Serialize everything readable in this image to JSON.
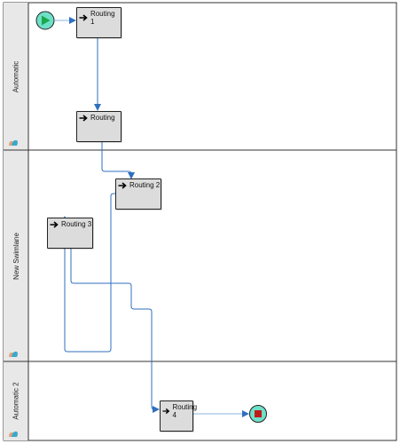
{
  "lanes": [
    {
      "label": "Automatic"
    },
    {
      "label": "New Swimlane"
    },
    {
      "label": "Automatic 2"
    }
  ],
  "tasks": [
    {
      "id": "routing-1",
      "label": "Routing 1",
      "icon": "arrow-right-icon"
    },
    {
      "id": "routing",
      "label": "Routing",
      "icon": "arrow-right-icon"
    },
    {
      "id": "routing-2",
      "label": "Routing 2",
      "icon": "arrow-right-icon"
    },
    {
      "id": "routing-3",
      "label": "Routing 3",
      "icon": "arrow-right-icon"
    },
    {
      "id": "routing-4",
      "label": "Routing 4",
      "icon": "arrow-right-icon"
    }
  ],
  "events": [
    {
      "id": "start",
      "type": "start-event",
      "icon": "play-icon",
      "color": "#1aa84b",
      "fill": "#6fe0c8"
    },
    {
      "id": "end",
      "type": "end-event",
      "icon": "stop-icon",
      "color": "#c21a1a",
      "fill": "#6fe0c8"
    }
  ],
  "colors": {
    "connector": "#2f6fbf",
    "lane_header": "#e8e8e8",
    "task_fill": "#dcdcdc",
    "lane_icon_orange": "#e8a27a",
    "lane_icon_blue": "#3aa9c9"
  }
}
